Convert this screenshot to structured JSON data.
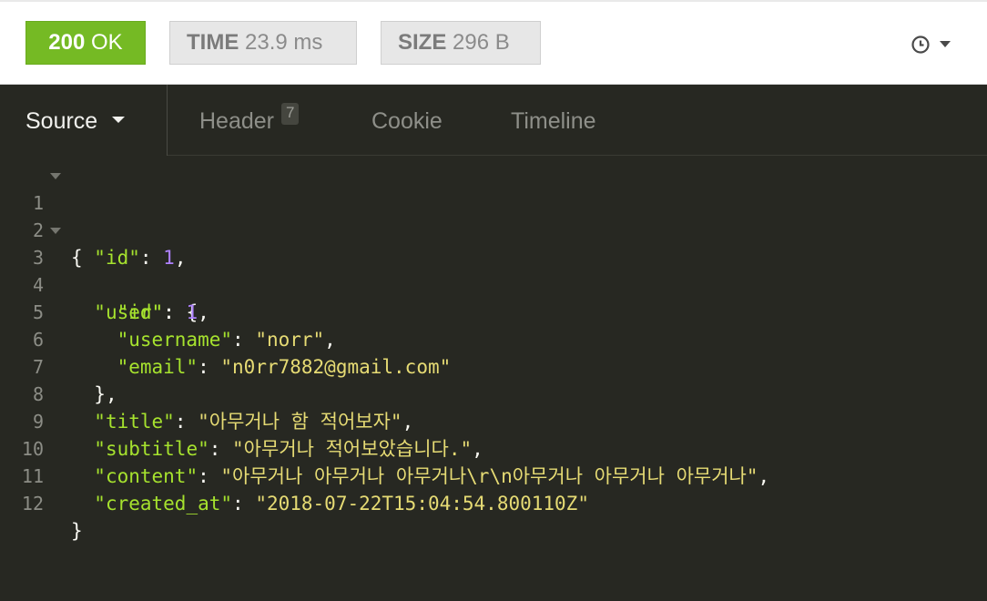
{
  "status": {
    "code": "200",
    "text": "OK",
    "color": "#75ba24",
    "time_label": "TIME",
    "time_value": "23.9 ms",
    "size_label": "SIZE",
    "size_value": "296 B",
    "history_icon": "clock-icon"
  },
  "tabs": {
    "source": "Source",
    "header": "Header",
    "header_count": "7",
    "cookie": "Cookie",
    "timeline": "Timeline"
  },
  "code": {
    "line_numbers": [
      "1",
      "2",
      "3",
      "4",
      "5",
      "6",
      "7",
      "8",
      "9",
      "10",
      "11",
      "12"
    ],
    "id_key": "\"id\"",
    "id_value": "1",
    "user_key": "\"user\"",
    "user_id_key": "\"id\"",
    "user_id_value": "1",
    "username_key": "\"username\"",
    "username_value": "\"norr\"",
    "email_key": "\"email\"",
    "email_value": "\"n0rr7882@gmail.com\"",
    "title_key": "\"title\"",
    "title_value": "\"아무거나 함 적어보자\"",
    "subtitle_key": "\"subtitle\"",
    "subtitle_value": "\"아무거나 적어보았습니다.\"",
    "content_key": "\"content\"",
    "content_value": "\"아무거나 아무거나 아무거나\\r\\n아무거나 아무거나 아무거나\"",
    "created_at_key": "\"created_at\"",
    "created_at_value": "\"2018-07-22T15:04:54.800110Z\""
  },
  "colors": {
    "background": "#272822",
    "key": "#a6e22e",
    "string": "#e6db74",
    "number": "#ae81ff"
  }
}
